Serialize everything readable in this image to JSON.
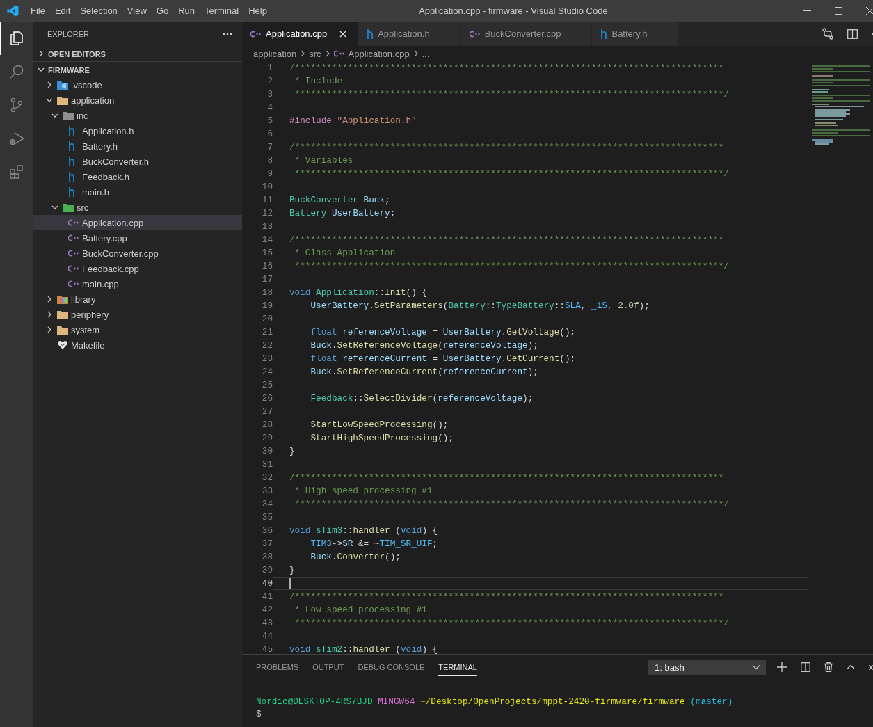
{
  "window": {
    "title": "Application.cpp - firmware - Visual Studio Code"
  },
  "menu": [
    "File",
    "Edit",
    "Selection",
    "View",
    "Go",
    "Run",
    "Terminal",
    "Help"
  ],
  "activity_bar": [
    {
      "kind": "explorer",
      "selected": true
    },
    {
      "kind": "search",
      "selected": false
    },
    {
      "kind": "source-control",
      "selected": false
    },
    {
      "kind": "run",
      "selected": false
    },
    {
      "kind": "extensions",
      "selected": false
    }
  ],
  "sidebar": {
    "title": "EXPLORER",
    "sections": [
      {
        "title": "OPEN EDITORS",
        "expanded": false
      },
      {
        "title": "FIRMWARE",
        "expanded": true,
        "children": [
          {
            "label": ".vscode",
            "kind": "vscode-folder",
            "expanded": false,
            "selected": false
          },
          {
            "label": "application",
            "kind": "folder",
            "expanded": true,
            "selected": false,
            "children": [
              {
                "label": "inc",
                "kind": "inc-folder",
                "expanded": true,
                "selected": false,
                "children": [
                  {
                    "label": "Application.h",
                    "kind": "h-file",
                    "selected": false
                  },
                  {
                    "label": "Battery.h",
                    "kind": "h-file",
                    "selected": false
                  },
                  {
                    "label": "BuckConverter.h",
                    "kind": "h-file",
                    "selected": false
                  },
                  {
                    "label": "Feedback.h",
                    "kind": "h-file",
                    "selected": false
                  },
                  {
                    "label": "main.h",
                    "kind": "h-file",
                    "selected": false
                  }
                ]
              },
              {
                "label": "src",
                "kind": "src-folder",
                "expanded": true,
                "selected": false,
                "children": [
                  {
                    "label": "Application.cpp",
                    "kind": "cpp-file",
                    "selected": true
                  },
                  {
                    "label": "Battery.cpp",
                    "kind": "cpp-file",
                    "selected": false
                  },
                  {
                    "label": "BuckConverter.cpp",
                    "kind": "cpp-file",
                    "selected": false
                  },
                  {
                    "label": "Feedback.cpp",
                    "kind": "cpp-file",
                    "selected": false
                  },
                  {
                    "label": "main.cpp",
                    "kind": "cpp-file",
                    "selected": false
                  }
                ]
              }
            ]
          },
          {
            "label": "library",
            "kind": "library-folder",
            "expanded": false,
            "selected": false
          },
          {
            "label": "periphery",
            "kind": "folder",
            "expanded": false,
            "selected": false
          },
          {
            "label": "system",
            "kind": "folder",
            "expanded": false,
            "selected": false
          },
          {
            "label": "Makefile",
            "kind": "makefile",
            "selected": false
          }
        ]
      }
    ]
  },
  "tabs": [
    {
      "label": "Application.cpp",
      "kind": "cpp",
      "selected": true
    },
    {
      "label": "Application.h",
      "kind": "h",
      "selected": false
    },
    {
      "label": "BuckConverter.cpp",
      "kind": "cpp",
      "selected": false
    },
    {
      "label": "Battery.h",
      "kind": "h",
      "selected": false
    }
  ],
  "breadcrumbs": [
    {
      "label": "application",
      "kind": "folder"
    },
    {
      "label": "src",
      "kind": "folder"
    },
    {
      "label": "Application.cpp",
      "kind": "cpp"
    },
    {
      "label": "...",
      "kind": "more"
    }
  ],
  "editor": {
    "lines": [
      {
        "number": "1",
        "current": false,
        "tokens": [
          {
            "kind": "comment",
            "text": "/*********************************************************************************"
          }
        ]
      },
      {
        "number": "2",
        "current": false,
        "tokens": [
          {
            "kind": "comment",
            "text": " * Include"
          }
        ]
      },
      {
        "number": "3",
        "current": false,
        "tokens": [
          {
            "kind": "comment",
            "text": " *********************************************************************************/"
          }
        ]
      },
      {
        "number": "4",
        "current": false
      },
      {
        "number": "5",
        "current": false,
        "tokens": [
          {
            "kind": "preproc",
            "text": "#include "
          },
          {
            "kind": "string",
            "text": "\"Application.h\""
          }
        ]
      },
      {
        "number": "6",
        "current": false
      },
      {
        "number": "7",
        "current": false,
        "tokens": [
          {
            "kind": "comment",
            "text": "/*********************************************************************************"
          }
        ]
      },
      {
        "number": "8",
        "current": false,
        "tokens": [
          {
            "kind": "comment",
            "text": " * Variables"
          }
        ]
      },
      {
        "number": "9",
        "current": false,
        "tokens": [
          {
            "kind": "comment",
            "text": " *********************************************************************************/"
          }
        ]
      },
      {
        "number": "10",
        "current": false
      },
      {
        "number": "11",
        "current": false,
        "tokens": [
          {
            "kind": "type",
            "text": "BuckConverter "
          },
          {
            "kind": "var",
            "text": "Buck"
          },
          {
            "kind": "plain",
            "text": ";"
          }
        ]
      },
      {
        "number": "12",
        "current": false,
        "tokens": [
          {
            "kind": "type",
            "text": "Battery "
          },
          {
            "kind": "var",
            "text": "UserBattery"
          },
          {
            "kind": "plain",
            "text": ";"
          }
        ]
      },
      {
        "number": "13",
        "current": false
      },
      {
        "number": "14",
        "current": false,
        "tokens": [
          {
            "kind": "comment",
            "text": "/*********************************************************************************"
          }
        ]
      },
      {
        "number": "15",
        "current": false,
        "tokens": [
          {
            "kind": "comment",
            "text": " * Class Application"
          }
        ]
      },
      {
        "number": "16",
        "current": false,
        "tokens": [
          {
            "kind": "comment",
            "text": " *********************************************************************************/"
          }
        ]
      },
      {
        "number": "17",
        "current": false
      },
      {
        "number": "18",
        "current": false,
        "tokens": [
          {
            "kind": "keyword",
            "text": "void "
          },
          {
            "kind": "type",
            "text": "Application"
          },
          {
            "kind": "plain",
            "text": "::"
          },
          {
            "kind": "func",
            "text": "Init"
          },
          {
            "kind": "plain",
            "text": "() {"
          }
        ]
      },
      {
        "number": "19",
        "current": false,
        "tokens": [
          {
            "kind": "var",
            "text": "    UserBattery"
          },
          {
            "kind": "plain",
            "text": "."
          },
          {
            "kind": "func",
            "text": "SetParameters"
          },
          {
            "kind": "plain",
            "text": "("
          },
          {
            "kind": "type",
            "text": "Battery"
          },
          {
            "kind": "plain",
            "text": "::"
          },
          {
            "kind": "type",
            "text": "TypeBattery"
          },
          {
            "kind": "plain",
            "text": "::"
          },
          {
            "kind": "macro",
            "text": "SLA"
          },
          {
            "kind": "plain",
            "text": ", "
          },
          {
            "kind": "macro",
            "text": "_1S"
          },
          {
            "kind": "plain",
            "text": ", "
          },
          {
            "kind": "number",
            "text": "2.0f"
          },
          {
            "kind": "plain",
            "text": ");"
          }
        ]
      },
      {
        "number": "20",
        "current": false
      },
      {
        "number": "21",
        "current": false,
        "tokens": [
          {
            "kind": "keyword",
            "text": "    float "
          },
          {
            "kind": "var",
            "text": "referenceVoltage"
          },
          {
            "kind": "plain",
            "text": " = "
          },
          {
            "kind": "var",
            "text": "UserBattery"
          },
          {
            "kind": "plain",
            "text": "."
          },
          {
            "kind": "func",
            "text": "GetVoltage"
          },
          {
            "kind": "plain",
            "text": "();"
          }
        ]
      },
      {
        "number": "22",
        "current": false,
        "tokens": [
          {
            "kind": "var",
            "text": "    Buck"
          },
          {
            "kind": "plain",
            "text": "."
          },
          {
            "kind": "func",
            "text": "SetReferenceVoltage"
          },
          {
            "kind": "plain",
            "text": "("
          },
          {
            "kind": "var",
            "text": "referenceVoltage"
          },
          {
            "kind": "plain",
            "text": ");"
          }
        ]
      },
      {
        "number": "23",
        "current": false,
        "tokens": [
          {
            "kind": "keyword",
            "text": "    float "
          },
          {
            "kind": "var",
            "text": "referenceCurrent"
          },
          {
            "kind": "plain",
            "text": " = "
          },
          {
            "kind": "var",
            "text": "UserBattery"
          },
          {
            "kind": "plain",
            "text": "."
          },
          {
            "kind": "func",
            "text": "GetCurrent"
          },
          {
            "kind": "plain",
            "text": "();"
          }
        ]
      },
      {
        "number": "24",
        "current": false,
        "tokens": [
          {
            "kind": "var",
            "text": "    Buck"
          },
          {
            "kind": "plain",
            "text": "."
          },
          {
            "kind": "func",
            "text": "SetReferenceCurrent"
          },
          {
            "kind": "plain",
            "text": "("
          },
          {
            "kind": "var",
            "text": "referenceCurrent"
          },
          {
            "kind": "plain",
            "text": ");"
          }
        ]
      },
      {
        "number": "25",
        "current": false
      },
      {
        "number": "26",
        "current": false,
        "tokens": [
          {
            "kind": "type",
            "text": "    Feedback"
          },
          {
            "kind": "plain",
            "text": "::"
          },
          {
            "kind": "func",
            "text": "SelectDivider"
          },
          {
            "kind": "plain",
            "text": "("
          },
          {
            "kind": "var",
            "text": "referenceVoltage"
          },
          {
            "kind": "plain",
            "text": ");"
          }
        ]
      },
      {
        "number": "27",
        "current": false
      },
      {
        "number": "28",
        "current": false,
        "tokens": [
          {
            "kind": "func",
            "text": "    StartLowSpeedProcessing"
          },
          {
            "kind": "plain",
            "text": "();"
          }
        ]
      },
      {
        "number": "29",
        "current": false,
        "tokens": [
          {
            "kind": "func",
            "text": "    StartHighSpeedProcessing"
          },
          {
            "kind": "plain",
            "text": "();"
          }
        ]
      },
      {
        "number": "30",
        "current": false,
        "tokens": [
          {
            "kind": "plain",
            "text": "}"
          }
        ]
      },
      {
        "number": "31",
        "current": false
      },
      {
        "number": "32",
        "current": false,
        "tokens": [
          {
            "kind": "comment",
            "text": "/*********************************************************************************"
          }
        ]
      },
      {
        "number": "33",
        "current": false,
        "tokens": [
          {
            "kind": "comment",
            "text": " * High speed processing #1"
          }
        ]
      },
      {
        "number": "34",
        "current": false,
        "tokens": [
          {
            "kind": "comment",
            "text": " *********************************************************************************/"
          }
        ]
      },
      {
        "number": "35",
        "current": false
      },
      {
        "number": "36",
        "current": false,
        "tokens": [
          {
            "kind": "keyword",
            "text": "void "
          },
          {
            "kind": "type",
            "text": "sTim3"
          },
          {
            "kind": "plain",
            "text": "::"
          },
          {
            "kind": "func",
            "text": "handler"
          },
          {
            "kind": "plain",
            "text": " ("
          },
          {
            "kind": "keyword",
            "text": "void"
          },
          {
            "kind": "plain",
            "text": ") {"
          }
        ]
      },
      {
        "number": "37",
        "current": false,
        "tokens": [
          {
            "kind": "macro",
            "text": "    TIM3"
          },
          {
            "kind": "plain",
            "text": "->"
          },
          {
            "kind": "var",
            "text": "SR"
          },
          {
            "kind": "plain",
            "text": " &= ~"
          },
          {
            "kind": "macro",
            "text": "TIM_SR_UIF"
          },
          {
            "kind": "plain",
            "text": ";"
          }
        ]
      },
      {
        "number": "38",
        "current": false,
        "tokens": [
          {
            "kind": "var",
            "text": "    Buck"
          },
          {
            "kind": "plain",
            "text": "."
          },
          {
            "kind": "func",
            "text": "Converter"
          },
          {
            "kind": "plain",
            "text": "();"
          }
        ]
      },
      {
        "number": "39",
        "current": false,
        "tokens": [
          {
            "kind": "plain",
            "text": "}"
          }
        ]
      },
      {
        "number": "40",
        "current": true
      },
      {
        "number": "41",
        "current": false,
        "tokens": [
          {
            "kind": "comment",
            "text": "/*********************************************************************************"
          }
        ]
      },
      {
        "number": "42",
        "current": false,
        "tokens": [
          {
            "kind": "comment",
            "text": " * Low speed processing #1"
          }
        ]
      },
      {
        "number": "43",
        "current": false,
        "tokens": [
          {
            "kind": "comment",
            "text": " *********************************************************************************/"
          }
        ]
      },
      {
        "number": "44",
        "current": false
      },
      {
        "number": "45",
        "current": false,
        "tokens": [
          {
            "kind": "keyword",
            "text": "void "
          },
          {
            "kind": "type",
            "text": "sTim2"
          },
          {
            "kind": "plain",
            "text": "::"
          },
          {
            "kind": "func",
            "text": "handler"
          },
          {
            "kind": "plain",
            "text": " ("
          },
          {
            "kind": "keyword",
            "text": "void"
          },
          {
            "kind": "plain",
            "text": ") {"
          }
        ]
      }
    ]
  },
  "panel": {
    "tabs": [
      {
        "label": "PROBLEMS",
        "selected": false
      },
      {
        "label": "OUTPUT",
        "selected": false
      },
      {
        "label": "DEBUG CONSOLE",
        "selected": false
      },
      {
        "label": "TERMINAL",
        "selected": true
      }
    ],
    "terminal_select": "1: bash",
    "terminal_lines": [
      [
        {
          "kind": "user",
          "text": "Nordic@DESKTOP-4RS7BJD "
        },
        {
          "kind": "system",
          "text": "MINGW64 "
        },
        {
          "kind": "path",
          "text": "~/Desktop/OpenProjects/mppt-2420-firmware/firmware "
        },
        {
          "kind": "branch",
          "text": "(master)"
        }
      ],
      [
        {
          "kind": "plain",
          "text": "$"
        }
      ]
    ]
  }
}
